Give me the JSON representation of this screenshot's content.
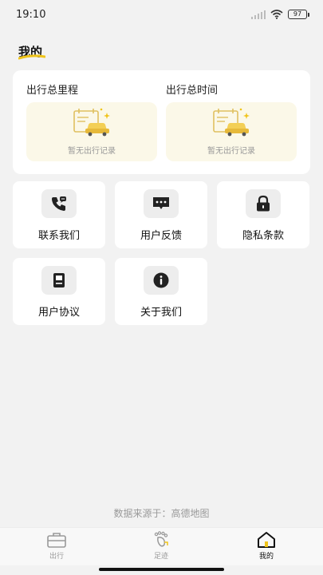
{
  "status_bar": {
    "time": "19:10",
    "battery": "97"
  },
  "page": {
    "title": "我的"
  },
  "stats": [
    {
      "label": "出行总里程",
      "empty_text": "暂无出行记录"
    },
    {
      "label": "出行总时间",
      "empty_text": "暂无出行记录"
    }
  ],
  "tiles": [
    {
      "label": "联系我们",
      "icon": "phone-icon"
    },
    {
      "label": "用户反馈",
      "icon": "chat-bubble-icon"
    },
    {
      "label": "隐私条款",
      "icon": "lock-icon"
    },
    {
      "label": "用户协议",
      "icon": "document-icon"
    },
    {
      "label": "关于我们",
      "icon": "info-icon"
    }
  ],
  "footer": {
    "source_text": "数据来源于：高德地图"
  },
  "tabbar": {
    "tabs": [
      {
        "label": "出行",
        "icon": "briefcase-icon"
      },
      {
        "label": "足迹",
        "icon": "footprint-icon"
      },
      {
        "label": "我的",
        "icon": "home-icon",
        "active": true
      }
    ]
  },
  "colors": {
    "accent": "#f0c419",
    "card_empty_bg": "#fbf8e8",
    "page_bg": "#f2f2f2"
  }
}
